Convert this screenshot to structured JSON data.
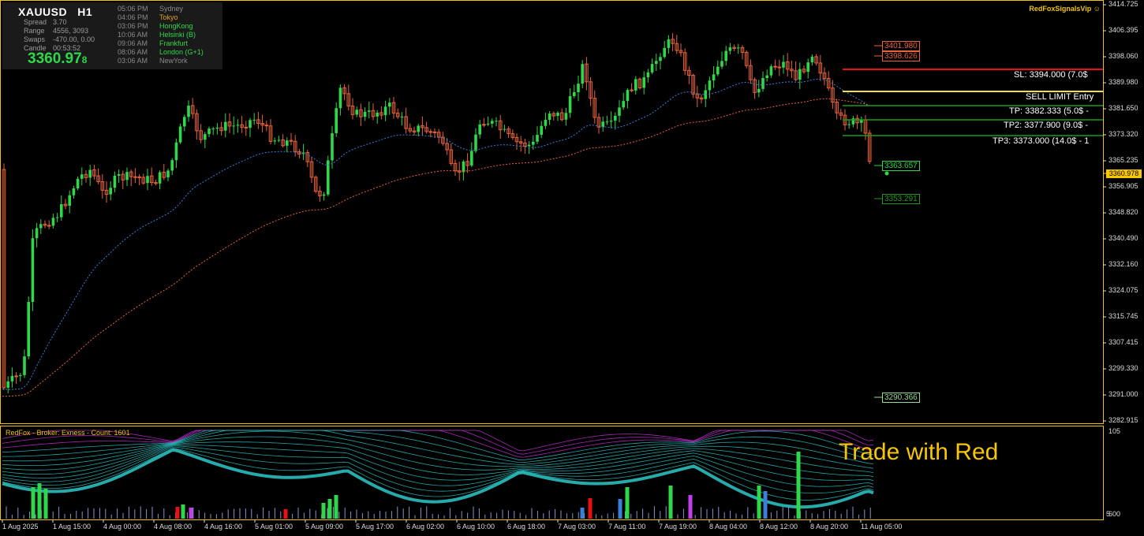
{
  "symbol": "XAUUSD",
  "timeframe": "H1",
  "info": [
    {
      "label": "Spread",
      "value": "3.70"
    },
    {
      "label": "Range",
      "value": "4556, 3093"
    },
    {
      "label": "Swaps",
      "value": "-470.00, 0.00"
    },
    {
      "label": "Candle",
      "value": "00:53:52"
    }
  ],
  "bid_price": "3360.97",
  "bid_price_fraction": "8",
  "sessions": [
    {
      "time": "05:06 PM",
      "name": "Sydney",
      "color": "#8a8a8a"
    },
    {
      "time": "04:06 PM",
      "name": "Tokyo",
      "color": "#e0a020"
    },
    {
      "time": "03:06 PM",
      "name": "HongKong",
      "color": "#2ed84a"
    },
    {
      "time": "10:06 AM",
      "name": "Helsinki  (B)",
      "color": "#2ed84a"
    },
    {
      "time": "09:06 AM",
      "name": "Frankfurt",
      "color": "#2ed84a"
    },
    {
      "time": "08:06 AM",
      "name": "London  (G+1)",
      "color": "#2ed84a"
    },
    {
      "time": "03:06 AM",
      "name": "NewYork",
      "color": "#8a8a8a"
    }
  ],
  "brand": "RedFoxSignalsVip",
  "brand_icon": "smiley-icon",
  "trade_lines": {
    "sl": "SL: 3394.000 (7.0$",
    "entry": "SELL LIMIT Entry",
    "tp1": "TP: 3382.333 (5.0$ -",
    "tp2": "TP2: 3377.900 (9.0$ -",
    "tp3": "TP3: 3373.000 (14.0$ - 1"
  },
  "price_boxes": {
    "r1": "3401.980",
    "r2": "3398.626",
    "s1": "3363.657",
    "s2": "3353.291",
    "s3": "3290.366"
  },
  "current_price": "3360.978",
  "price_axis": [
    "3414.725",
    "3406.395",
    "3398.060",
    "3389.980",
    "3381.650",
    "3373.320",
    "3365.235",
    "3356.905",
    "3348.820",
    "3340.490",
    "3332.160",
    "3324.075",
    "3315.745",
    "3307.415",
    "3299.330",
    "3291.000",
    "3282.915"
  ],
  "date_axis": [
    "1 Aug 2025",
    "1 Aug 15:00",
    "4 Aug 00:00",
    "4 Aug 08:00",
    "4 Aug 16:00",
    "5 Aug 01:00",
    "5 Aug 09:00",
    "5 Aug 17:00",
    "6 Aug 02:00",
    "6 Aug 10:00",
    "6 Aug 18:00",
    "7 Aug 03:00",
    "7 Aug 11:00",
    "7 Aug 19:00",
    "8 Aug 04:00",
    "8 Aug 12:00",
    "8 Aug 20:00",
    "11 Aug 05:00"
  ],
  "indicator": {
    "title": "RedFox - Broker: Exness - Count: 1601",
    "scale_top": "105",
    "scale_bottom": "600",
    "scale_marker": "5"
  },
  "overlay_text": "Trade with Red",
  "colors": {
    "bull": "#2ed84a",
    "bear": "#e8623c",
    "fast_ma": "#3a7fd8",
    "slow_ma": "#e8623c",
    "sl_line": "#e81010",
    "entry_line": "#f0e040",
    "tp_line": "#1e9a1e",
    "ribbon": "#2bbcbc",
    "ribbon_fast": "#c030d0",
    "panel_border": "#f0c400"
  }
}
